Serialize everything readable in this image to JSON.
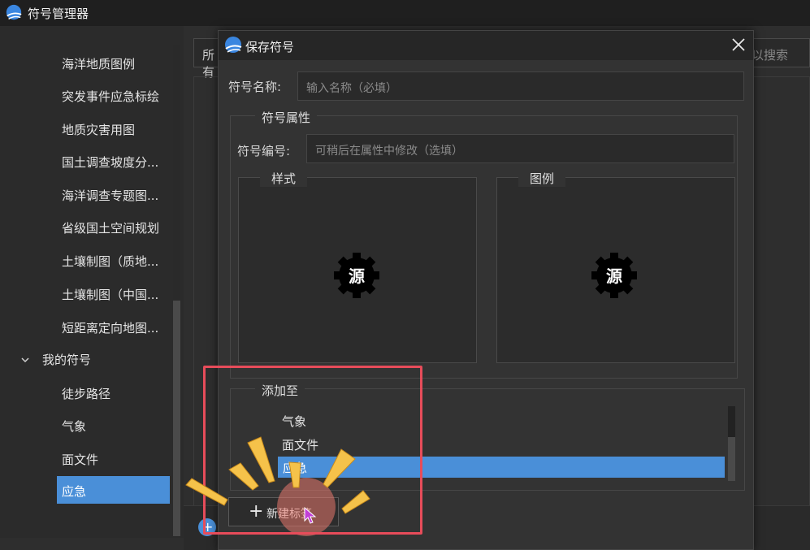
{
  "app": {
    "title": "符号管理器"
  },
  "sidebar": {
    "items": [
      {
        "label": "海洋地质图例"
      },
      {
        "label": "突发事件应急标绘"
      },
      {
        "label": "地质灾害用图"
      },
      {
        "label": "国土调查坡度分..."
      },
      {
        "label": "海洋调查专题图..."
      },
      {
        "label": "省级国土空间规划"
      },
      {
        "label": "土壤制图（质地..."
      },
      {
        "label": "土壤制图（中国..."
      },
      {
        "label": "短距离定向地图..."
      }
    ],
    "group": {
      "label": "我的符号"
    },
    "sub_items": [
      {
        "label": "徒步路径"
      },
      {
        "label": "气象"
      },
      {
        "label": "面文件"
      }
    ],
    "selected": {
      "label": "应急"
    }
  },
  "background": {
    "filter_partial": "所有",
    "search_partial": "以搜索"
  },
  "dialog": {
    "title": "保存符号",
    "name_label": "符号名称:",
    "name_placeholder": "输入名称（必填）",
    "attr_group_title": "符号属性",
    "code_label": "符号编号:",
    "code_placeholder": "可稍后在属性中修改（选填）",
    "style_title": "样式",
    "legend_title": "图例",
    "symbol_glyph": "源",
    "add_to_title": "添加至",
    "list_items": [
      {
        "label": "气象"
      },
      {
        "label": "面文件"
      }
    ],
    "list_selected": {
      "label": "应急"
    },
    "new_tag_plus": "+",
    "new_tag_label": "新建标签"
  },
  "colors": {
    "accent": "#4a8fd8",
    "highlight": "#e74c5a",
    "burst": "#f5c24a"
  }
}
